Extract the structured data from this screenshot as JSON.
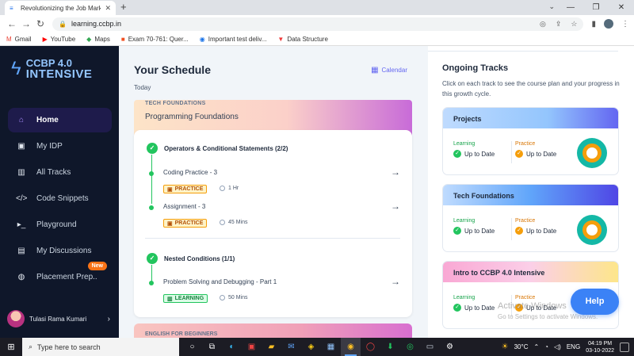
{
  "browser": {
    "tab_title": "Revolutionizing the Job Market |",
    "url": "learning.ccbp.in",
    "bookmarks": [
      {
        "label": "Gmail",
        "icon": "gmail-icon",
        "glyph": "M",
        "color": "#ea4335"
      },
      {
        "label": "YouTube",
        "icon": "youtube-icon",
        "glyph": "▶",
        "color": "#ff0000"
      },
      {
        "label": "Maps",
        "icon": "maps-icon",
        "glyph": "◆",
        "color": "#34a853"
      },
      {
        "label": "Exam 70-761: Quer...",
        "icon": "microsoft-icon",
        "glyph": "■",
        "color": "#f25022"
      },
      {
        "label": "Important test deliv...",
        "icon": "compass-icon",
        "glyph": "◉",
        "color": "#1a73e8"
      },
      {
        "label": "Data Structure",
        "icon": "vivaldi-icon",
        "glyph": "▼",
        "color": "#ef3939"
      }
    ]
  },
  "sidebar": {
    "logo_line1": "CCBP 4.0",
    "logo_line2": "INTENSIVE",
    "items": [
      {
        "label": "Home",
        "icon": "home-icon",
        "glyph": "⌂",
        "active": true
      },
      {
        "label": "My IDP",
        "icon": "idp-icon",
        "glyph": "▣",
        "active": false
      },
      {
        "label": "All Tracks",
        "icon": "tracks-icon",
        "glyph": "▥",
        "active": false
      },
      {
        "label": "Code Snippets",
        "icon": "code-icon",
        "glyph": "</>",
        "active": false
      },
      {
        "label": "Playground",
        "icon": "terminal-icon",
        "glyph": "▸_",
        "active": false
      },
      {
        "label": "My Discussions",
        "icon": "discussions-icon",
        "glyph": "▤",
        "active": false
      },
      {
        "label": "Placement Prep..",
        "icon": "placement-icon",
        "glyph": "◍",
        "active": false,
        "badge": "New"
      }
    ],
    "user_name": "Tulasi Rama Kumari"
  },
  "schedule": {
    "title": "Your Schedule",
    "calendar_label": "Calendar",
    "today_label": "Today",
    "track_label": "TECH FOUNDATIONS",
    "track_name": "Programming Foundations",
    "topic1": "Operators & Conditional Statements (2/2)",
    "item1": {
      "title": "Coding Practice - 3",
      "tag": "PRACTICE",
      "duration": "1 Hr"
    },
    "item2": {
      "title": "Assignment - 3",
      "tag": "PRACTICE",
      "duration": "45 Mins"
    },
    "topic2": "Nested Conditions (1/1)",
    "item3": {
      "title": "Problem Solving and Debugging - Part 1",
      "tag": "LEARNING",
      "duration": "50 Mins"
    },
    "next_track_label": "ENGLISH FOR BEGINNERS"
  },
  "ongoing": {
    "title": "Ongoing Tracks",
    "description": "Click on each track to see the course plan and your progress in this growth cycle.",
    "learning_label": "Learning",
    "practice_label": "Practice",
    "status": "Up to Date",
    "tracks": [
      {
        "name": "Projects"
      },
      {
        "name": "Tech Foundations"
      },
      {
        "name": "Intro to CCBP 4.0 Intensive"
      }
    ]
  },
  "help_label": "Help",
  "watermark": {
    "line1": "Activate Windows",
    "line2": "Go to Settings to activate Windows."
  },
  "taskbar": {
    "search_placeholder": "Type here to search",
    "temperature": "30°C",
    "language": "ENG",
    "time": "04:19 PM",
    "date": "03-10-2022"
  }
}
